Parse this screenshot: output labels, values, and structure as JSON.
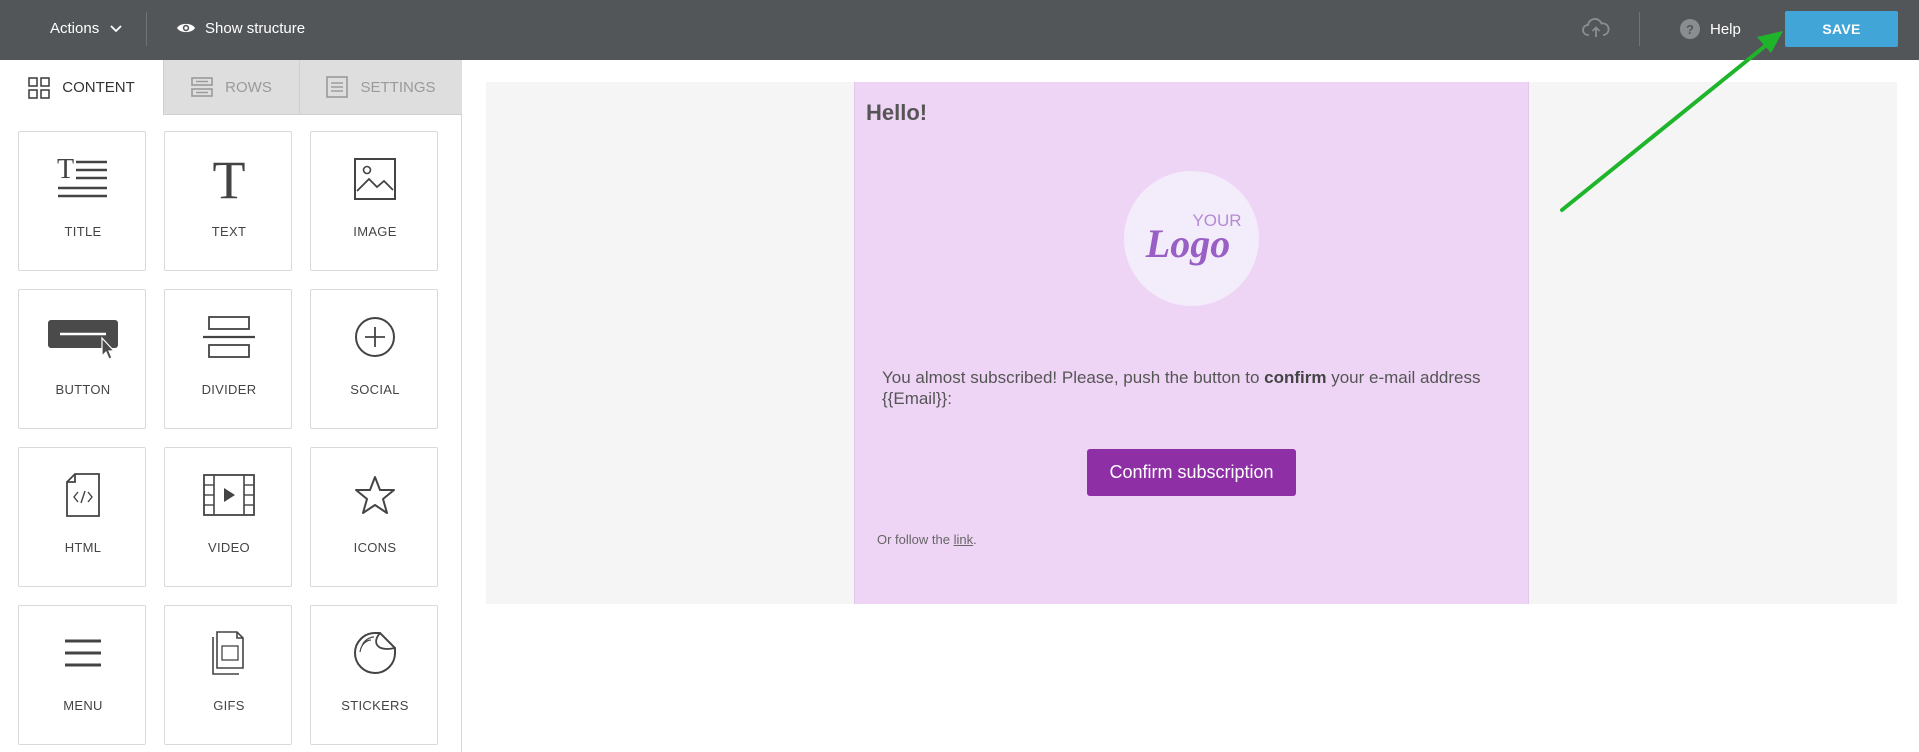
{
  "topbar": {
    "actions_label": "Actions",
    "structure_label": "Show structure",
    "help_label": "Help",
    "help_glyph": "?",
    "save_label": "SAVE"
  },
  "tabs": [
    {
      "label": "CONTENT",
      "icon": "grid-icon"
    },
    {
      "label": "ROWS",
      "icon": "rows-icon"
    },
    {
      "label": "SETTINGS",
      "icon": "settings-icon"
    }
  ],
  "blocks": [
    {
      "label": "TITLE",
      "icon": "title-icon"
    },
    {
      "label": "TEXT",
      "icon": "text-icon"
    },
    {
      "label": "IMAGE",
      "icon": "image-icon"
    },
    {
      "label": "BUTTON",
      "icon": "button-icon"
    },
    {
      "label": "DIVIDER",
      "icon": "divider-icon"
    },
    {
      "label": "SOCIAL",
      "icon": "social-icon"
    },
    {
      "label": "HTML",
      "icon": "html-icon"
    },
    {
      "label": "VIDEO",
      "icon": "video-icon"
    },
    {
      "label": "ICONS",
      "icon": "star-icon"
    },
    {
      "label": "MENU",
      "icon": "menu-icon"
    },
    {
      "label": "GIFS",
      "icon": "gifs-icon"
    },
    {
      "label": "STICKERS",
      "icon": "sticker-icon"
    }
  ],
  "email": {
    "greeting": "Hello!",
    "logo_top": "YOUR",
    "logo_main": "Logo",
    "message_before": "You almost subscribed! Please, push the button to ",
    "message_bold": "confirm",
    "message_after": " your e-mail address {{Email}}:",
    "button_label": "Confirm subscription",
    "follow_prefix": "Or follow the ",
    "follow_link": "link",
    "follow_suffix": "."
  },
  "colors": {
    "topbar": "#525659",
    "save": "#42a5d8",
    "email_bg": "#efd5f5",
    "confirm": "#8e2fa6",
    "arrow": "#1fb52a"
  }
}
